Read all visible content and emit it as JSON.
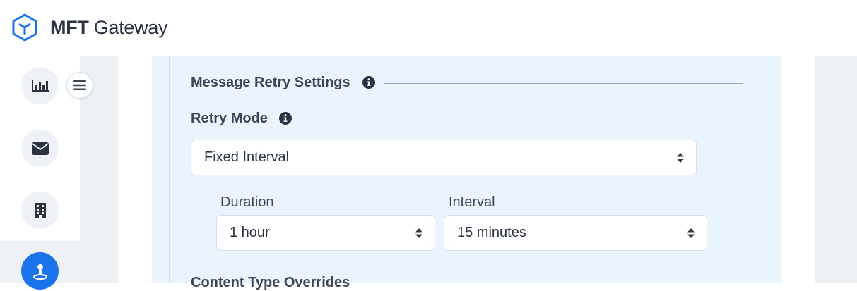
{
  "header": {
    "brand_bold": "MFT",
    "brand_light": " Gateway"
  },
  "sidebar": {
    "items": [
      {
        "icon": "bar-chart-icon",
        "active": false
      },
      {
        "icon": "envelope-icon",
        "active": false
      },
      {
        "icon": "building-icon",
        "active": false
      },
      {
        "icon": "user-station-icon",
        "active": true
      }
    ]
  },
  "retry_settings": {
    "section_title": "Message Retry Settings",
    "retry_mode_label": "Retry Mode",
    "retry_mode_value": "Fixed Interval",
    "duration_label": "Duration",
    "duration_value": "1 hour",
    "interval_label": "Interval",
    "interval_value": "15 minutes"
  },
  "next_section_title": "Content Type Overrides",
  "colors": {
    "accent": "#1a73e8",
    "panel_blue": "#eaf4fe",
    "page_gray": "#edf1f4"
  }
}
